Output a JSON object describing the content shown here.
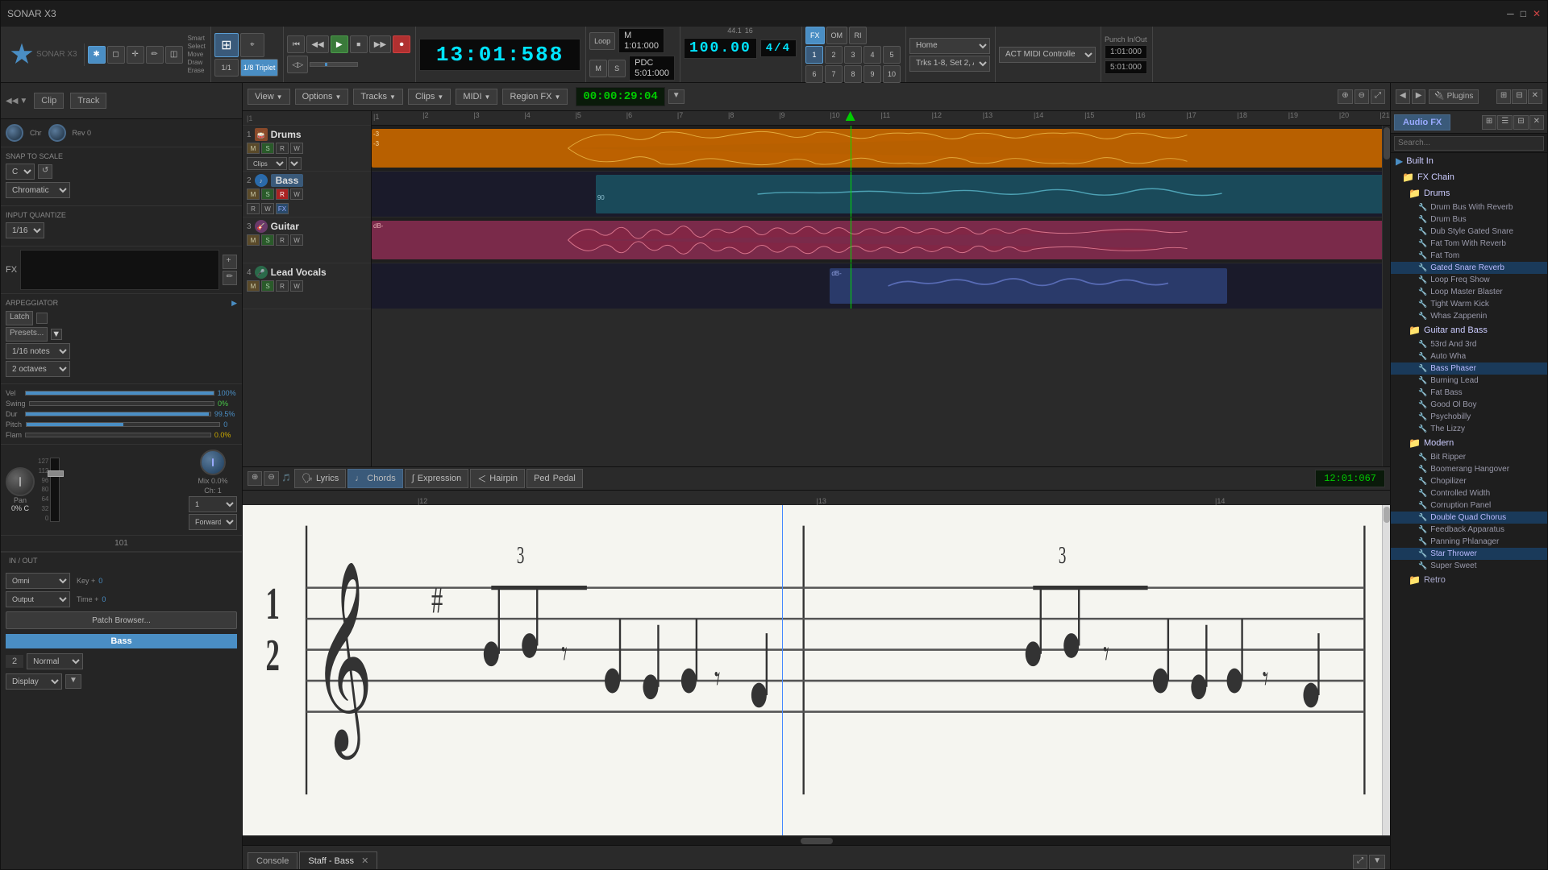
{
  "app": {
    "title": "SONAR X3",
    "logo_text": "SONAR X3"
  },
  "toolbar": {
    "tools": [
      "Smart",
      "Select",
      "Move",
      "Draw",
      "Erase"
    ],
    "snap_label": "1/8 Triplet",
    "quantize_label": "1/1",
    "quantize_num": "3",
    "transport_time": "13:01:588",
    "tempo": "100.00",
    "time_sig": "4/4",
    "sample_rate": "44.1",
    "bit_depth": "16",
    "loop_start": "1:01:000",
    "loop_end": "5:01:000",
    "punch_in": "1:01:000",
    "punch_out": "5:01:000",
    "controller": "ACT MIDI Controlle",
    "home_label": "Home",
    "tracks_label": "Trks 1-8, Set 2, AC..."
  },
  "left_panel": {
    "clip_label": "Clip",
    "track_label": "Track",
    "snap_to_scale": {
      "title": "SNAP TO SCALE",
      "key": "C",
      "scale": "Chromatic"
    },
    "input_quantize": {
      "title": "INPUT QUANTIZE",
      "value": "1/16"
    },
    "arpeggiator": {
      "title": "ARPEGGIATOR",
      "latch": "Latch",
      "presets": "Presets...",
      "notes": "1/16 notes",
      "octaves": "2 octaves"
    },
    "velocity": {
      "label": "Vel",
      "value": "100%",
      "swing_label": "Swing",
      "swing_value": "0%",
      "dur_label": "Dur",
      "dur_value": "99.5%",
      "pitch_label": "Pitch",
      "pitch_value": "0",
      "flam_label": "Flam",
      "flam_value": "0.0%"
    },
    "pan": {
      "label": "Pan",
      "value": "0% C"
    },
    "channel": {
      "label": "Ch: 1"
    },
    "direction": "Forward",
    "channel_num": "101",
    "in_out": "IN / OUT",
    "key_plus": "Key +",
    "time_plus": "Time +",
    "output": "Output",
    "patch_browser": "Patch Browser...",
    "instrument_name": "Bass",
    "channel_display": "2",
    "mode": "Normal",
    "display": "Display"
  },
  "secondary_toolbar": {
    "view": "View",
    "options": "Options",
    "tracks": "Tracks",
    "clips": "Clips",
    "midi": "MIDI",
    "region_fx": "Region FX",
    "time_display": "00:00:29:04"
  },
  "tracks": [
    {
      "number": "1",
      "name": "Drums",
      "type": "drums",
      "color": "#cc7700",
      "has_clip": true,
      "clip_start": 0
    },
    {
      "number": "2",
      "name": "Bass",
      "type": "bass",
      "color": "#226688",
      "has_clip": true,
      "clip_start": 22
    },
    {
      "number": "3",
      "name": "Guitar",
      "type": "guitar",
      "color": "#aa4466",
      "has_clip": true,
      "clip_start": 0
    },
    {
      "number": "4",
      "name": "Lead Vocals",
      "type": "vocals",
      "color": "#5566aa",
      "has_clip": true,
      "clip_start": 45
    }
  ],
  "timeline": {
    "measures": [
      1,
      2,
      3,
      4,
      5,
      6,
      7,
      8,
      9,
      10,
      11,
      12,
      13,
      14,
      15,
      16,
      17,
      18,
      19,
      20,
      21
    ],
    "playhead_position": "47%"
  },
  "notation": {
    "toolbar_btns": [
      "Lyrics",
      "Chords",
      "Expression",
      "Hairpin",
      "Pedal"
    ],
    "time_display": "12:01:067",
    "current_measure": "12",
    "tab_console": "Console",
    "tab_staff": "Staff - Bass"
  },
  "fx_panel": {
    "header": "Audio FX",
    "tree": {
      "root": "Built In",
      "categories": [
        {
          "name": "FX Chain",
          "expanded": true,
          "subcategories": [
            {
              "name": "Drums",
              "expanded": true,
              "items": [
                "Drum Bus With Reverb",
                "Drum Bus",
                "Dub Style Gated Snare",
                "Fat Tom With Reverb",
                "Fat Tom",
                "Gated Snare Reverb",
                "Loop Freq Show",
                "Loop Master Blaster",
                "Tight Warm Kick",
                "Whas Zappenin"
              ]
            },
            {
              "name": "Guitar and Bass",
              "expanded": true,
              "items": [
                "53rd And 3rd",
                "Auto Wha",
                "Bass Phaser",
                "Burning Lead",
                "Fat Bass",
                "Good Ol Boy",
                "Psychobilly",
                "The Lizzy"
              ]
            },
            {
              "name": "Modern",
              "expanded": true,
              "items": [
                "Bit Ripper",
                "Boomerang Hangover",
                "Chopilizer",
                "Controlled Width",
                "Corruption Panel",
                "Double Quad Chorus",
                "Feedback Apparatus",
                "Panning Phlanager",
                "Star Thrower",
                "Super Sweet"
              ]
            },
            {
              "name": "Retro",
              "expanded": false,
              "items": []
            }
          ]
        }
      ]
    }
  }
}
